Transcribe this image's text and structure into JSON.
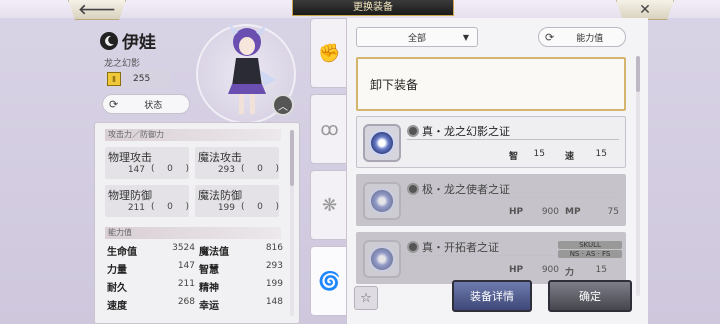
{
  "header": {
    "title": "更换装备",
    "back_icon": "arrow-left-icon",
    "close_icon": "close-icon"
  },
  "character": {
    "name": "伊娃",
    "subtitle": "龙之幻影",
    "level": "255",
    "status_button": "状态"
  },
  "stats": {
    "section_attack": "攻击力／防御力",
    "attack": [
      {
        "label": "物理攻击",
        "value": "147",
        "bonus": "0"
      },
      {
        "label": "魔法攻击",
        "value": "293",
        "bonus": "0"
      },
      {
        "label": "物理防御",
        "value": "211",
        "bonus": "0"
      },
      {
        "label": "魔法防御",
        "value": "199",
        "bonus": "0"
      }
    ],
    "section_ability": "能力值",
    "ability": [
      {
        "l1": "生命值",
        "v1": "3524",
        "l2": "魔法值",
        "v2": "816"
      },
      {
        "l1": "力量",
        "v1": "147",
        "l2": "智慧",
        "v2": "293"
      },
      {
        "l1": "耐久",
        "v1": "211",
        "l2": "精神",
        "v2": "199"
      },
      {
        "l1": "速度",
        "v1": "268",
        "l2": "幸运",
        "v2": "148"
      }
    ]
  },
  "filter": {
    "selected": "全部",
    "sort_label": "能力值"
  },
  "unequip_label": "卸下装备",
  "items": [
    {
      "name": "真・龙之幻影之证",
      "s1k": "智",
      "s1v": "15",
      "s2k": "速",
      "s2v": "15"
    },
    {
      "name": "极・龙之使者之证",
      "s1k": "HP",
      "s1v": "900",
      "s2k": "MP",
      "s2v": "75"
    },
    {
      "name": "真・开拓者之证",
      "s1k": "HP",
      "s1v": "900",
      "s2k": "力",
      "s2v": "15"
    }
  ],
  "skull_tag": {
    "line1": "SKULL",
    "line2": "NS · AS · FS"
  },
  "buttons": {
    "detail": "装备详情",
    "confirm": "确定"
  }
}
